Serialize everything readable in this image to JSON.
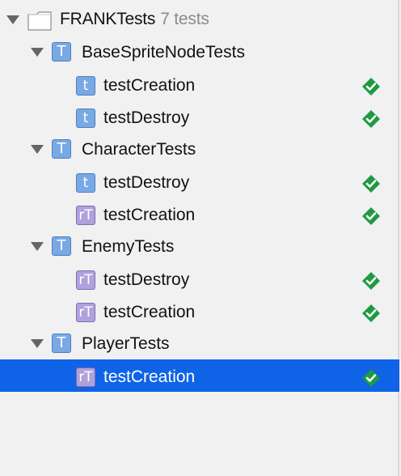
{
  "root": {
    "name": "FRANKTests",
    "count_label": "7 tests"
  },
  "groups": [
    {
      "name": "BaseSpriteNodeTests",
      "tests": [
        {
          "name": "testCreation",
          "icon": "blue-test-icon",
          "status": "passed"
        },
        {
          "name": "testDestroy",
          "icon": "blue-test-icon",
          "status": "passed"
        }
      ]
    },
    {
      "name": "CharacterTests",
      "tests": [
        {
          "name": "testDestroy",
          "icon": "blue-test-icon",
          "status": "passed"
        },
        {
          "name": "testCreation",
          "icon": "purple-test-icon",
          "status": "passed"
        }
      ]
    },
    {
      "name": "EnemyTests",
      "tests": [
        {
          "name": "testDestroy",
          "icon": "purple-test-icon",
          "status": "passed"
        },
        {
          "name": "testCreation",
          "icon": "purple-test-icon",
          "status": "passed"
        }
      ]
    },
    {
      "name": "PlayerTests",
      "tests": [
        {
          "name": "testCreation",
          "icon": "purple-test-icon",
          "status": "passed",
          "selected": true
        }
      ]
    }
  ],
  "colors": {
    "selection": "#0f63e6",
    "pass": "#1f9a43",
    "blue_icon": "#78a9e4",
    "purple_icon": "#b0a1db"
  }
}
